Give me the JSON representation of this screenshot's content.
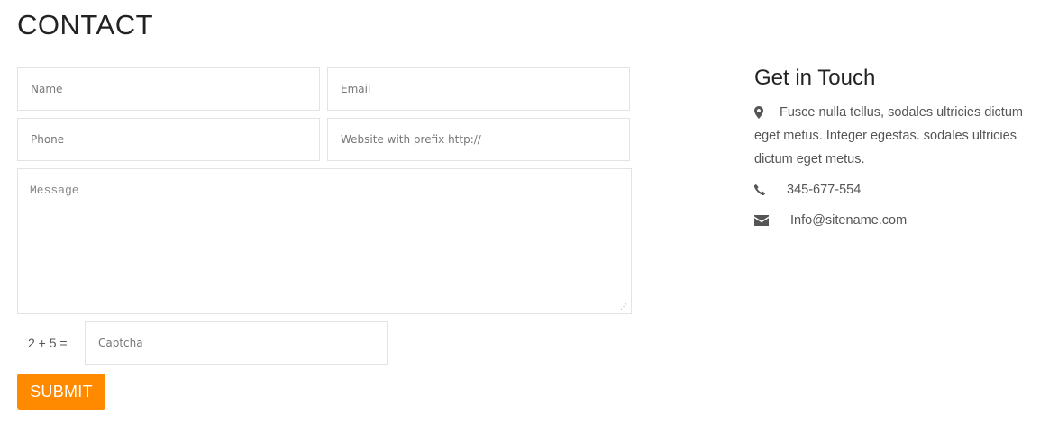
{
  "page": {
    "title": "CONTACT"
  },
  "form": {
    "name_placeholder": "Name",
    "email_placeholder": "Email",
    "phone_placeholder": "Phone",
    "website_placeholder": "Website with prefix http://",
    "message_placeholder": "Message",
    "captcha_question": "2 + 5 =",
    "captcha_placeholder": "Captcha",
    "submit_label": "SUBMIT"
  },
  "contact_info": {
    "title": "Get in Touch",
    "address": "Fusce nulla tellus, sodales ultricies dictum eget metus. Integer egestas. sodales ultricies dictum eget metus.",
    "address_icon": "map-marker-icon",
    "phone": "345-677-554",
    "phone_icon": "phone-icon",
    "email": "Info@sitename.com",
    "email_icon": "envelope-icon"
  },
  "colors": {
    "accent": "#ff8a00",
    "heading": "#222222",
    "text": "#555555",
    "border": "#e3e3e3"
  }
}
